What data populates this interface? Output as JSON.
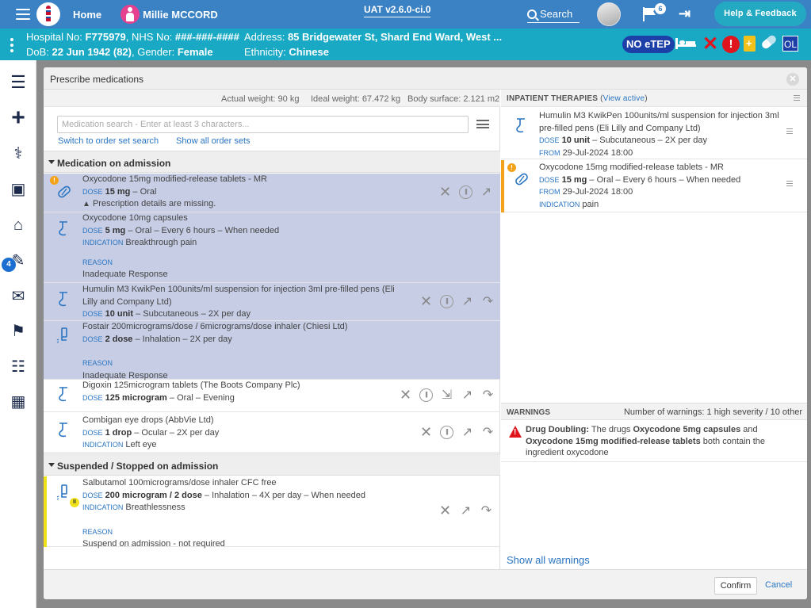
{
  "topbar": {
    "home": "Home",
    "patient_name": "Millie MCCORD",
    "version": "UAT v2.6.0-ci.0",
    "search": "Search",
    "flag_count": "6",
    "help": "Help & Feedback"
  },
  "banner": {
    "hospital_label": "Hospital No:",
    "hospital_no": "F775979",
    "nhs_label": "NHS No:",
    "nhs_no": "###-###-####",
    "address_label": "Address:",
    "address": "85 Bridgewater St, Shard End Ward, West ...",
    "dob_label": "DoB:",
    "dob": "22 Jun 1942 (82)",
    "gender_label": "Gender:",
    "gender": "Female",
    "ethnicity_label": "Ethnicity:",
    "ethnicity": "Chinese",
    "no_etep": "NO eTEP",
    "ol": "OL"
  },
  "leftnav": {
    "badge": "4"
  },
  "modal": {
    "title": "Prescribe medications",
    "weights": {
      "actual": "Actual weight: 90 kg",
      "ideal": "Ideal weight: 67.472 kg",
      "bsa": "Body surface: 2.121 m2"
    },
    "search_placeholder": "Medication search - Enter at least 3 characters...",
    "switch_link": "Switch to order set search",
    "show_order_sets": "Show all order sets",
    "section_admission": "Medication on admission",
    "section_suspended": "Suspended / Stopped on admission",
    "meds": [
      {
        "name": "Oxycodone 15mg modified-release tablets - MR",
        "dose_label": "DOSE",
        "dose": "15 mg",
        "rest": " – Oral",
        "note": "Prescription details are missing."
      },
      {
        "name": "Oxycodone 10mg capsules",
        "dose_label": "DOSE",
        "dose": "5 mg",
        "rest": " – Oral – Every 6 hours – When needed",
        "ind_label": "INDICATION",
        "ind": "Breakthrough pain",
        "reason_label": "REASON",
        "reason": "Inadequate Response"
      },
      {
        "name": "Humulin M3 KwikPen 100units/ml suspension for injection 3ml pre-filled pens (Eli",
        "name2": "Lilly and Company Ltd)",
        "dose_label": "DOSE",
        "dose": "10 unit",
        "rest": " – Subcutaneous – 2X per day"
      },
      {
        "name": "Fostair 200micrograms/dose / 6micrograms/dose inhaler (Chiesi Ltd)",
        "dose_label": "DOSE",
        "dose": "2 dose",
        "rest": " – Inhalation – 2X per day",
        "reason_label": "REASON",
        "reason": "Inadequate Response"
      },
      {
        "name": "Digoxin 125microgram tablets (The Boots Company Plc)",
        "dose_label": "DOSE",
        "dose": "125 microgram",
        "rest": " – Oral – Evening"
      },
      {
        "name": "Combigan eye drops (AbbVie Ltd)",
        "dose_label": "DOSE",
        "dose": "1 drop",
        "rest": " – Ocular – 2X per day",
        "ind_label": "INDICATION",
        "ind": "Left eye"
      },
      {
        "name": "Salbutamol 100micrograms/dose inhaler CFC free",
        "dose_label": "DOSE",
        "dose": "200 microgram / 2 dose",
        "rest": " – Inhalation – 4X per day – When needed",
        "ind_label": "INDICATION",
        "ind": "Breathlessness",
        "reason_label": "REASON",
        "reason": "Suspend on admission - not required"
      }
    ],
    "inpatient": {
      "title": "INPATIENT THERAPIES",
      "view_active": "View active",
      "items": [
        {
          "name": "Humulin M3 KwikPen 100units/ml suspension for injection 3ml",
          "name2": "pre-filled pens (Eli Lilly and Company Ltd)",
          "dose_label": "DOSE",
          "dose": "10 unit",
          "rest": " – Subcutaneous – 2X per day",
          "from_label": "FROM",
          "from": "29-Jul-2024 18:00"
        },
        {
          "name": "Oxycodone 15mg modified-release tablets - MR",
          "dose_label": "DOSE",
          "dose": "15 mg",
          "rest": " – Oral – Every 6 hours – When needed",
          "from_label": "FROM",
          "from": "29-Jul-2024 18:00",
          "ind_label": "INDICATION",
          "ind": "pain"
        }
      ]
    },
    "warnings": {
      "title": "WARNINGS",
      "count": "Number of warnings: 1 high severity / 10 other",
      "w_title": "Drug Doubling:",
      "w_a": " The drugs ",
      "w_drug1": "Oxycodone 5mg capsules",
      "w_and": " and",
      "w_drug2": "Oxycodone 15mg modified-release tablets",
      "w_b": " both contain the ingredient oxycodone",
      "show_all": "Show all warnings"
    },
    "confirm": "Confirm",
    "cancel": "Cancel"
  }
}
